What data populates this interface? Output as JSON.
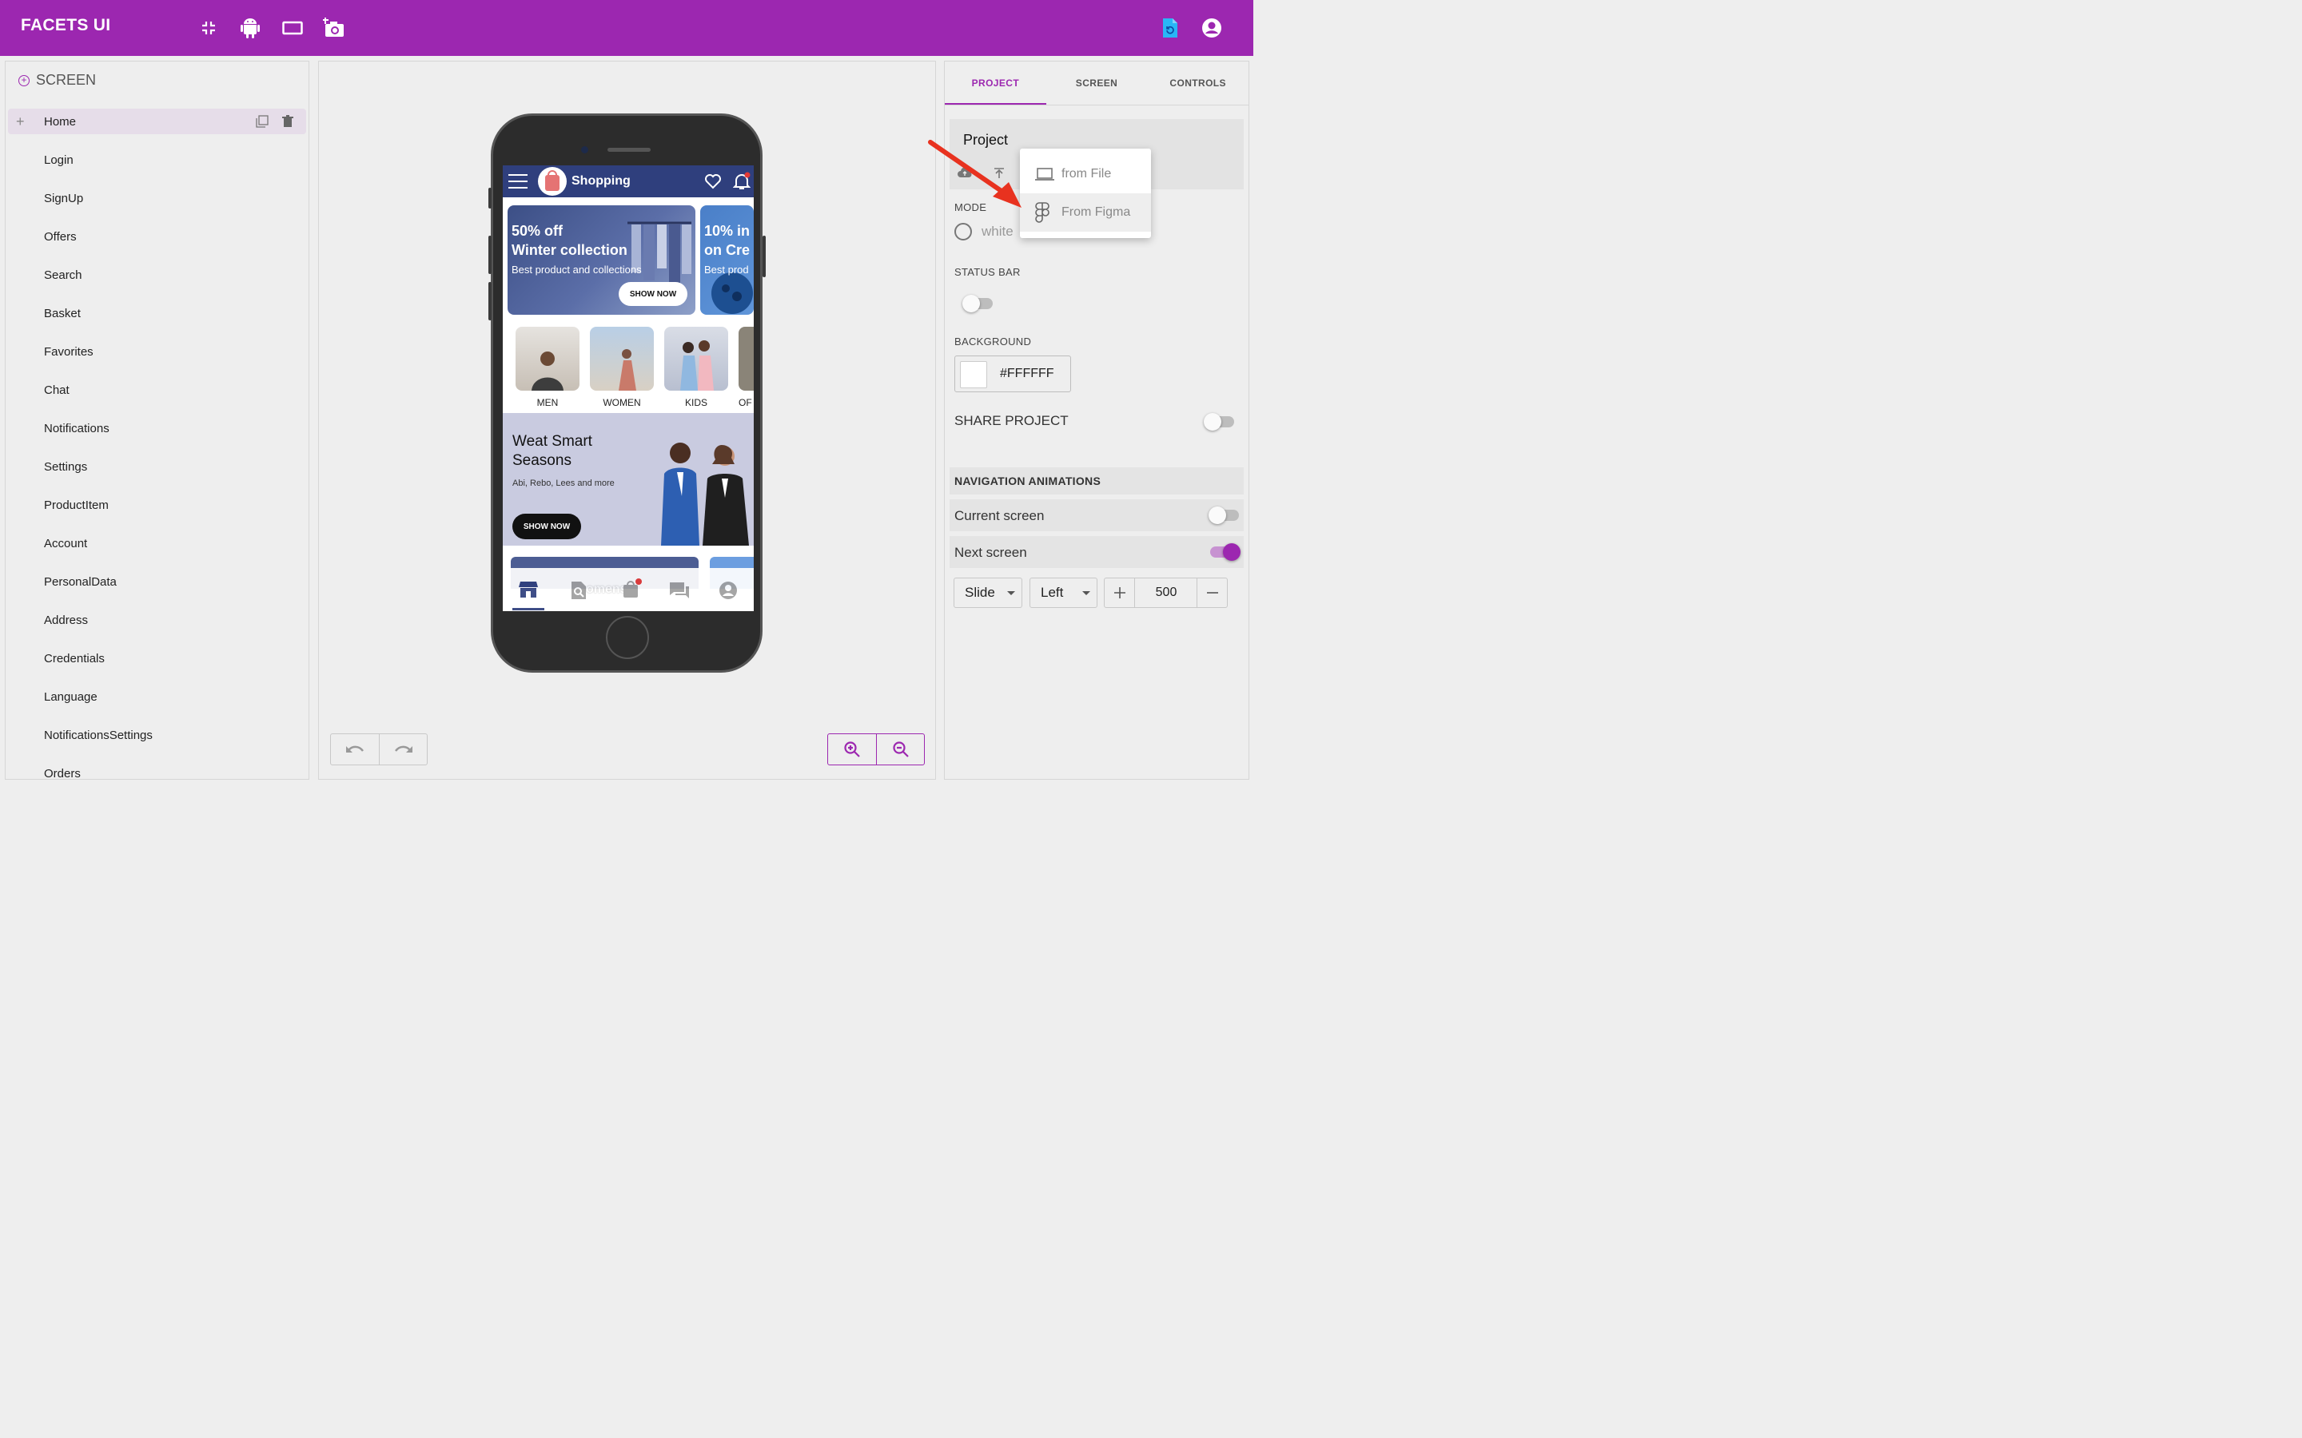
{
  "header": {
    "title": "FACETS UI"
  },
  "left_panel": {
    "title": "SCREEN",
    "screens": [
      "Home",
      "Login",
      "SignUp",
      "Offers",
      "Search",
      "Basket",
      "Favorites",
      "Chat",
      "Notifications",
      "Settings",
      "ProductItem",
      "Account",
      "PersonalData",
      "Address",
      "Credentials",
      "Language",
      "NotificationsSettings",
      "Orders"
    ],
    "selected": "Home"
  },
  "phone": {
    "app_title": "Shopping",
    "banner1": {
      "title1": "50% off",
      "title2": "Winter collection",
      "subtitle": "Best product and collections",
      "button": "SHOW NOW"
    },
    "banner2": {
      "title1": "10% in",
      "title2": "on Cre",
      "subtitle": "Best prod"
    },
    "categories": [
      "MEN",
      "WOMEN",
      "KIDS",
      "OF"
    ],
    "promo": {
      "title": "Weat Smart Seasons",
      "subtitle": "Abi, Rebo, Lees and more",
      "button": "SHOW NOW"
    },
    "partial_text": "omens"
  },
  "right_panel": {
    "tabs": [
      "PROJECT",
      "SCREEN",
      "CONTROLS"
    ],
    "active_tab": "PROJECT",
    "project_label": "Project",
    "mode_label": "MODE",
    "mode_value": "white",
    "status_bar_label": "STATUS BAR",
    "background_label": "BACKGROUND",
    "background_value": "#FFFFFF",
    "share_label": "SHARE PROJECT",
    "nav_anim_label": "NAVIGATION ANIMATIONS",
    "current_screen_label": "Current screen",
    "next_screen_label": "Next screen",
    "anim_type": "Slide",
    "anim_direction": "Left",
    "anim_duration": "500"
  },
  "import_menu": {
    "from_file": "from File",
    "from_figma": "From Figma"
  },
  "colors": {
    "accent": "#9c27b0",
    "app_bar": "#2f3f7d",
    "annotation_arrow": "#e8321f"
  }
}
